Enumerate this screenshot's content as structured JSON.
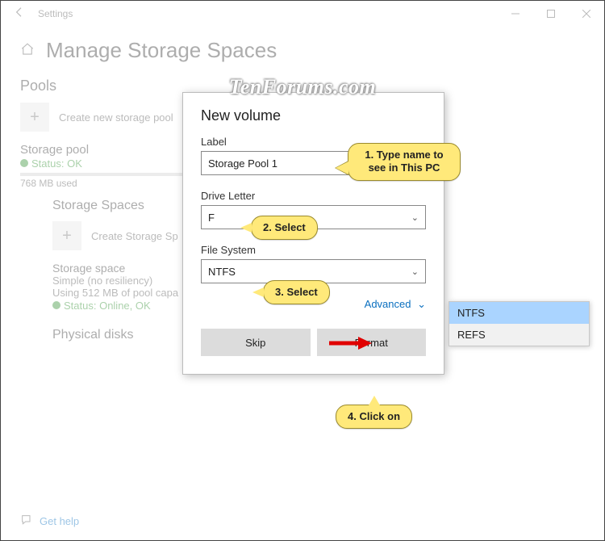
{
  "titlebar": {
    "title": "Settings"
  },
  "page": {
    "title": "Manage Storage Spaces"
  },
  "pools": {
    "heading": "Pools",
    "create_label": "Create new storage pool",
    "pool_name": "Storage pool",
    "status": "Status: OK",
    "used": "768 MB used"
  },
  "spaces": {
    "heading": "Storage Spaces",
    "create_label": "Create Storage Sp",
    "space_name": "Storage space",
    "resiliency": "Simple (no resiliency)",
    "usage": "Using 512 MB of pool capa",
    "status": "Status: Online, OK"
  },
  "disks": {
    "heading": "Physical disks"
  },
  "help": {
    "label": "Get help"
  },
  "dialog": {
    "title": "New volume",
    "label_label": "Label",
    "label_value": "Storage Pool 1",
    "drive_label": "Drive Letter",
    "drive_value": "F",
    "fs_label": "File System",
    "fs_value": "NTFS",
    "advanced": "Advanced",
    "skip": "Skip",
    "format": "Format"
  },
  "flyout": {
    "opt1": "NTFS",
    "opt2": "REFS"
  },
  "callouts": {
    "c1": "1. Type name to see in This PC",
    "c2": "2. Select",
    "c3": "3. Select",
    "c4": "4. Click on"
  },
  "watermark": "TenForums.com"
}
